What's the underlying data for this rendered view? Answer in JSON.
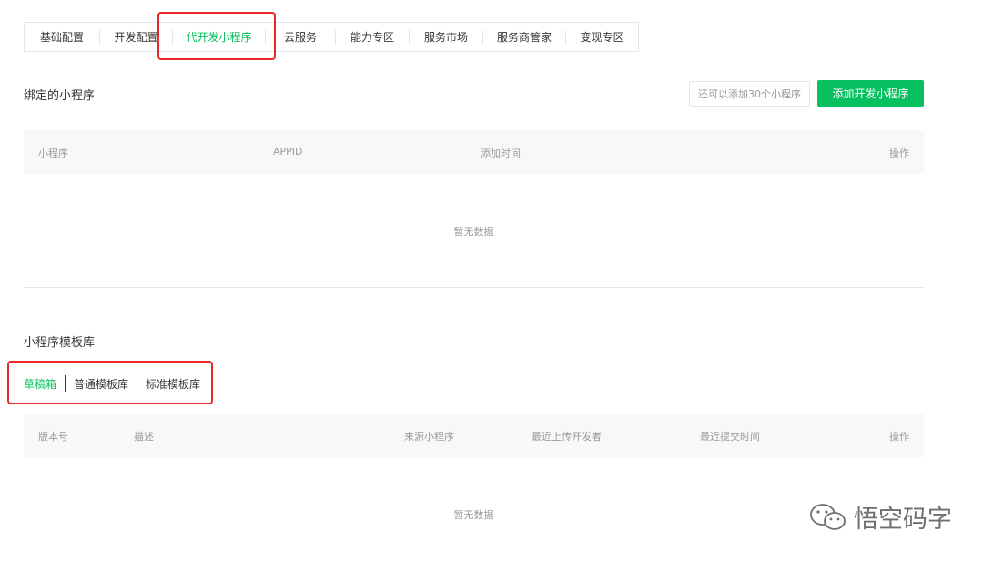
{
  "tabs": [
    {
      "label": "基础配置",
      "active": false
    },
    {
      "label": "开发配置",
      "active": false
    },
    {
      "label": "代开发小程序",
      "active": true
    },
    {
      "label": "云服务",
      "active": false
    },
    {
      "label": "能力专区",
      "active": false
    },
    {
      "label": "服务市场",
      "active": false
    },
    {
      "label": "服务商管家",
      "active": false
    },
    {
      "label": "变现专区",
      "active": false
    }
  ],
  "bound": {
    "title": "绑定的小程序",
    "quota_text": "还可以添加30个小程序",
    "add_button": "添加开发小程序",
    "columns": [
      "小程序",
      "APPID",
      "添加时间",
      "操作"
    ],
    "empty_text": "暂无数据"
  },
  "templates": {
    "title": "小程序模板库",
    "subtabs": [
      {
        "label": "草稿箱",
        "active": true
      },
      {
        "label": "普通模板库",
        "active": false
      },
      {
        "label": "标准模板库",
        "active": false
      }
    ],
    "columns": [
      "版本号",
      "描述",
      "来源小程序",
      "最近上传开发者",
      "最近提交时间",
      "操作"
    ],
    "empty_text": "暂无数据"
  },
  "watermark": {
    "text": "悟空码字",
    "icon": "wechat-icon"
  },
  "colors": {
    "accent": "#07c160",
    "highlight": "#ea2a2a",
    "header_bg": "#f6f8f9",
    "muted_text": "#9a9a9a"
  }
}
